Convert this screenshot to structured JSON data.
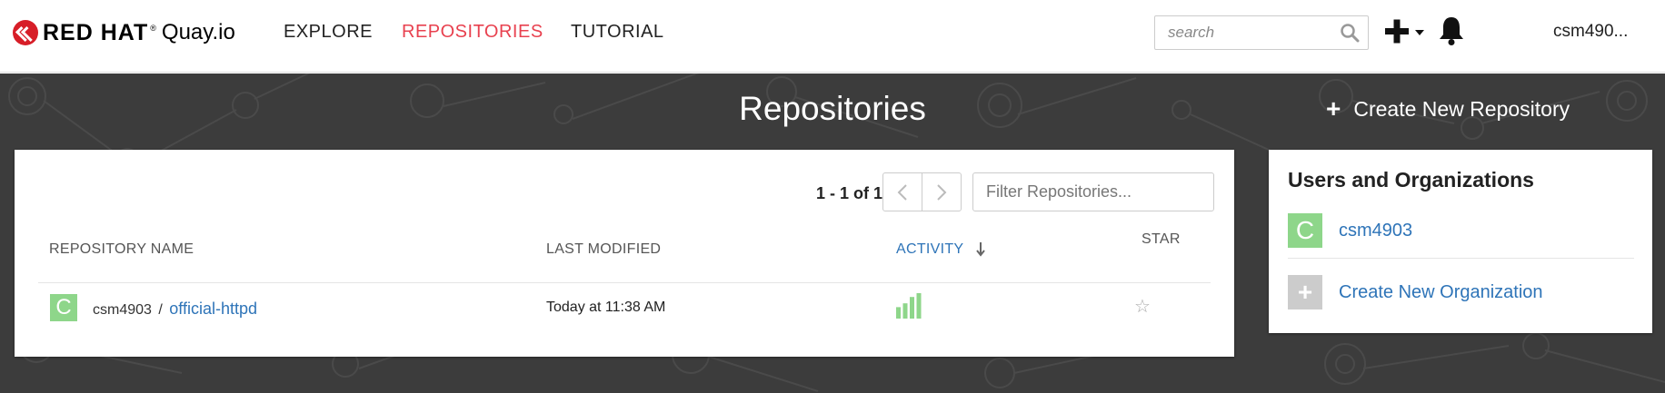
{
  "brand": {
    "name": "RED HAT",
    "product": "Quay.io",
    "reg": "®"
  },
  "nav": {
    "explore": "EXPLORE",
    "repositories": "REPOSITORIES",
    "tutorial": "TUTORIAL"
  },
  "search": {
    "placeholder": "search"
  },
  "user": {
    "name": "csm490..."
  },
  "header": {
    "title": "Repositories",
    "create_repo": "Create New Repository"
  },
  "repo_list": {
    "count": "1 - 1 of 1",
    "filter_placeholder": "Filter Repositories...",
    "columns": {
      "name": "REPOSITORY NAME",
      "modified": "LAST MODIFIED",
      "activity": "ACTIVITY",
      "star": "STAR"
    },
    "rows": [
      {
        "avatar": "C",
        "namespace": "csm4903",
        "separator": "/",
        "name": "official-httpd",
        "last_modified": "Today at 11:38 AM",
        "activity_levels": [
          0.45,
          0.6,
          0.85,
          1.0
        ],
        "starred": false
      }
    ]
  },
  "side": {
    "title": "Users and Organizations",
    "user": {
      "avatar": "C",
      "name": "csm4903"
    },
    "create_org": {
      "icon": "+",
      "label": "Create New Organization"
    }
  },
  "colors": {
    "accent": "#e8414f",
    "link": "#2e74b8",
    "band": "#3c3c3c",
    "avatar": "#8ed68a",
    "activity": "#8ed68a"
  }
}
